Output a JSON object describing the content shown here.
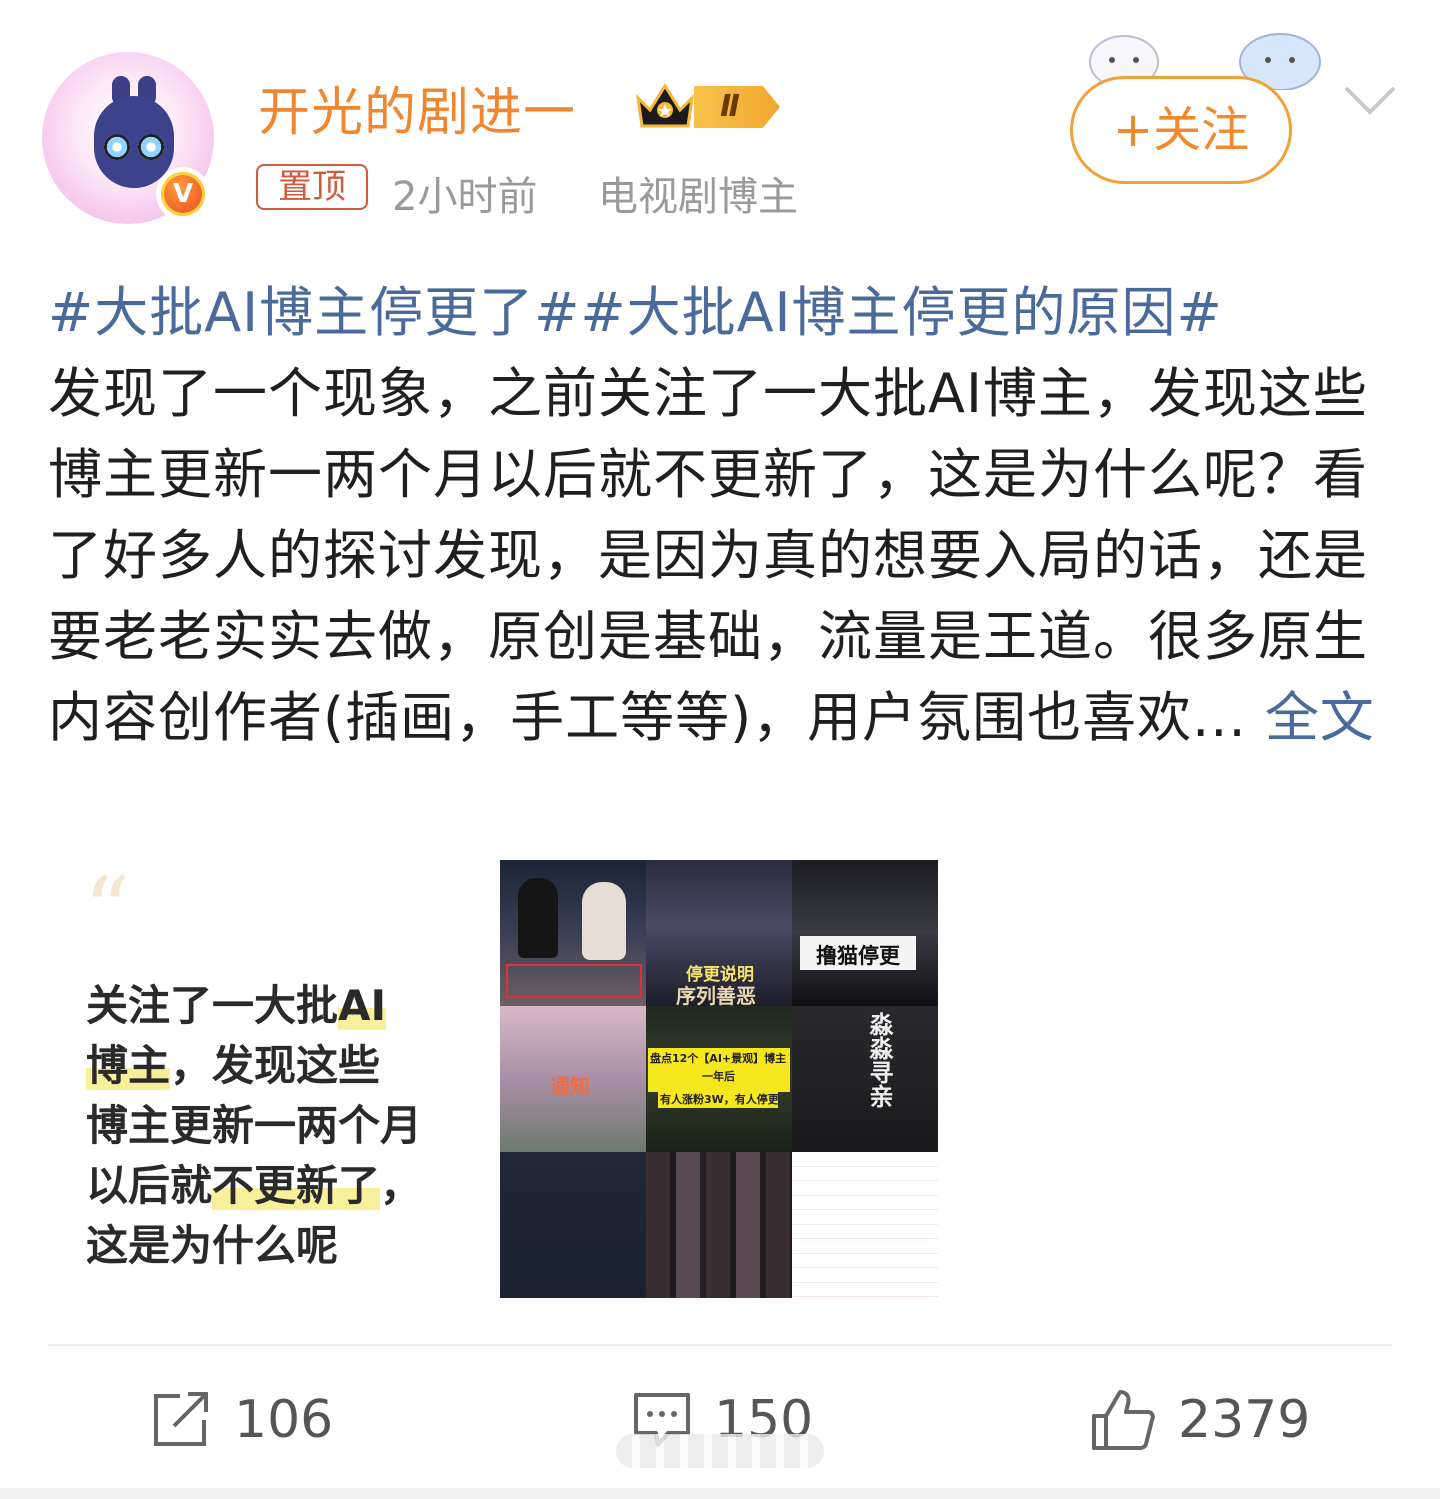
{
  "header": {
    "username": "开光的剧进一",
    "level_badge": "Ⅱ",
    "verified_badge": "V",
    "pinned_label": "置顶",
    "time": "2小时前",
    "category": "电视剧博主",
    "follow_label": "+关注"
  },
  "post": {
    "topic1": "#大批AI博主停更了#",
    "topic2": "#大批AI博主停更的原因#",
    "body": "发现了一个现象，之前关注了一大批AI博主，发现这些博主更新一两个月以后就不更新了，这是为什么呢？看了好多人的探讨发现，是因为真的想要入局的话，还是要老老实实去做，原创是基础，流量是王道。很多原生内容创作者(插画，手工等等)，用户氛围也喜欢...",
    "more_link": "全文"
  },
  "quote_card": {
    "mark": "“",
    "line1_a": "关注了一大批",
    "line1_hl": "AI",
    "line2_hl": "博主",
    "line2_b": "，发现这些",
    "line3": "博主更新一两个月",
    "line4_a": "以后就",
    "line4_hl": "不更新了",
    "line4_b": "，",
    "line5": "这是为什么呢"
  },
  "image_grid": {
    "tile2_caption": "停更说明",
    "tile2_sub": "序列善恶",
    "tile3_caption": "撸猫停更",
    "tile4_caption": "通知",
    "tile5_line1": "盘点12个【AI+景观】博主",
    "tile5_line2": "一年后",
    "tile5_line3": "有人涨粉3W，有人停更",
    "tile6_caption": "淼淼寻亲"
  },
  "actions": {
    "repost_count": "106",
    "comment_count": "150",
    "like_count": "2379"
  },
  "colors": {
    "username": "#f0862f",
    "topic": "#4a6a9b",
    "follow": "#f08a2c",
    "highlight": "#f8ef9a"
  },
  "icons": [
    "crown-icon",
    "verified-v-icon",
    "chevron-down-icon",
    "repost-icon",
    "comment-icon",
    "like-icon"
  ]
}
